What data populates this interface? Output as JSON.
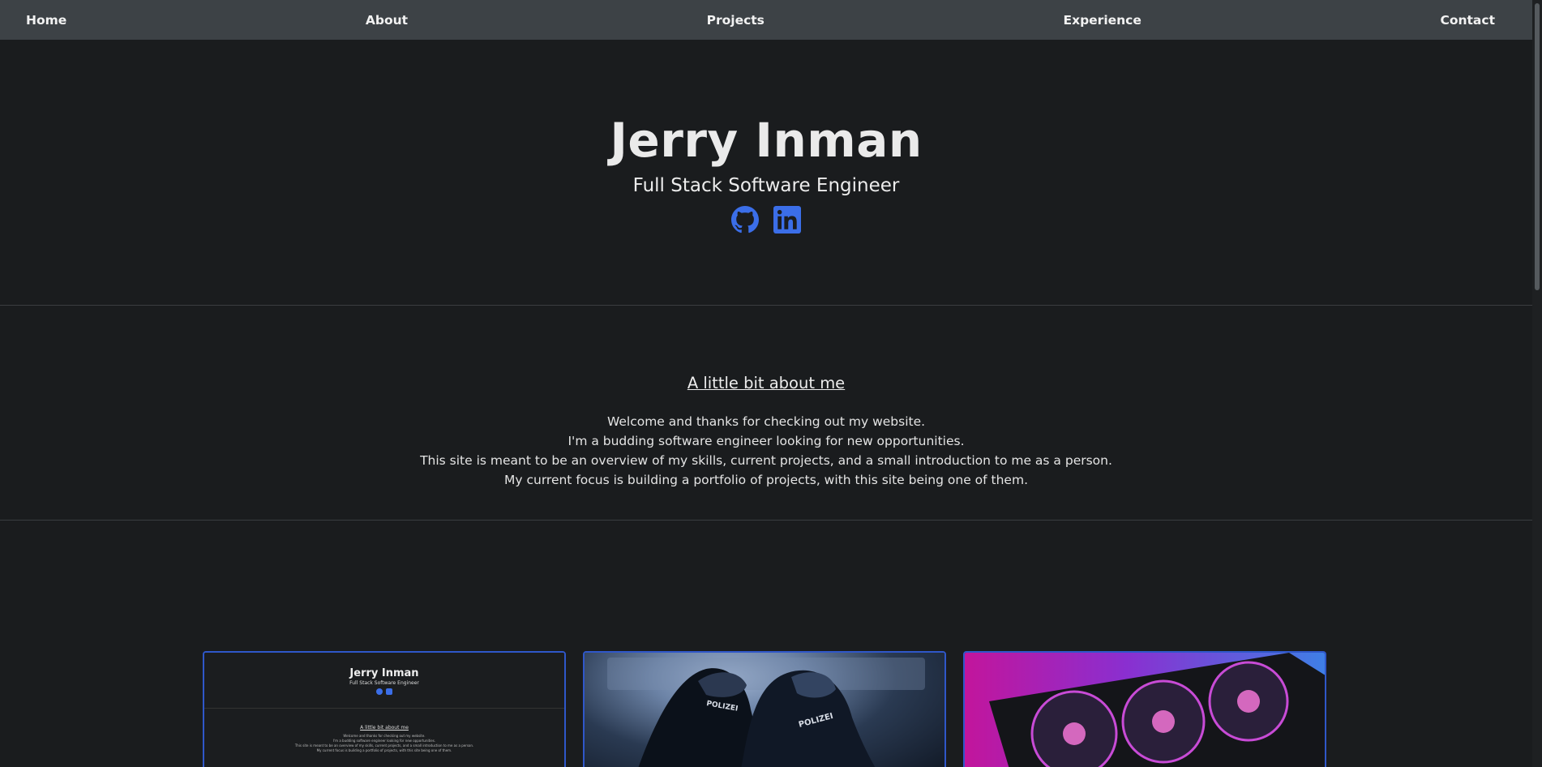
{
  "nav": {
    "items": [
      "Home",
      "About",
      "Projects",
      "Experience",
      "Contact"
    ]
  },
  "hero": {
    "name": "Jerry Inman",
    "subtitle": "Full Stack Software Engineer",
    "icons": [
      "github-icon",
      "linkedin-icon"
    ]
  },
  "about": {
    "heading": "A little bit about me",
    "lines": [
      "Welcome and thanks for checking out my website.",
      "I'm a budding software engineer looking for new opportunities.",
      "This site is meant to be an overview of my skills, current projects, and a small introduction to me as a person.",
      "My current focus is building a portfolio of projects, with this site being one of them."
    ]
  },
  "projects": {
    "preview": {
      "name": "Jerry Inman",
      "subtitle": "Full Stack Software Engineer",
      "heading": "A little bit about me",
      "lines": [
        "Welcome and thanks for checking out my website.",
        "I'm a budding software engineer looking for new opportunities.",
        "This site is meant to be an overview of my skills, current projects, and a small introduction to me as a person.",
        "My current focus is building a portfolio of projects, with this site being one of them."
      ]
    },
    "badge_text": [
      "POLIZEI",
      "POLIZEI"
    ]
  },
  "colors": {
    "accent": "#2f57c9",
    "icon": "#3b6ee8",
    "nav_bg": "#3d4246",
    "page_bg": "#1a1c1e"
  }
}
